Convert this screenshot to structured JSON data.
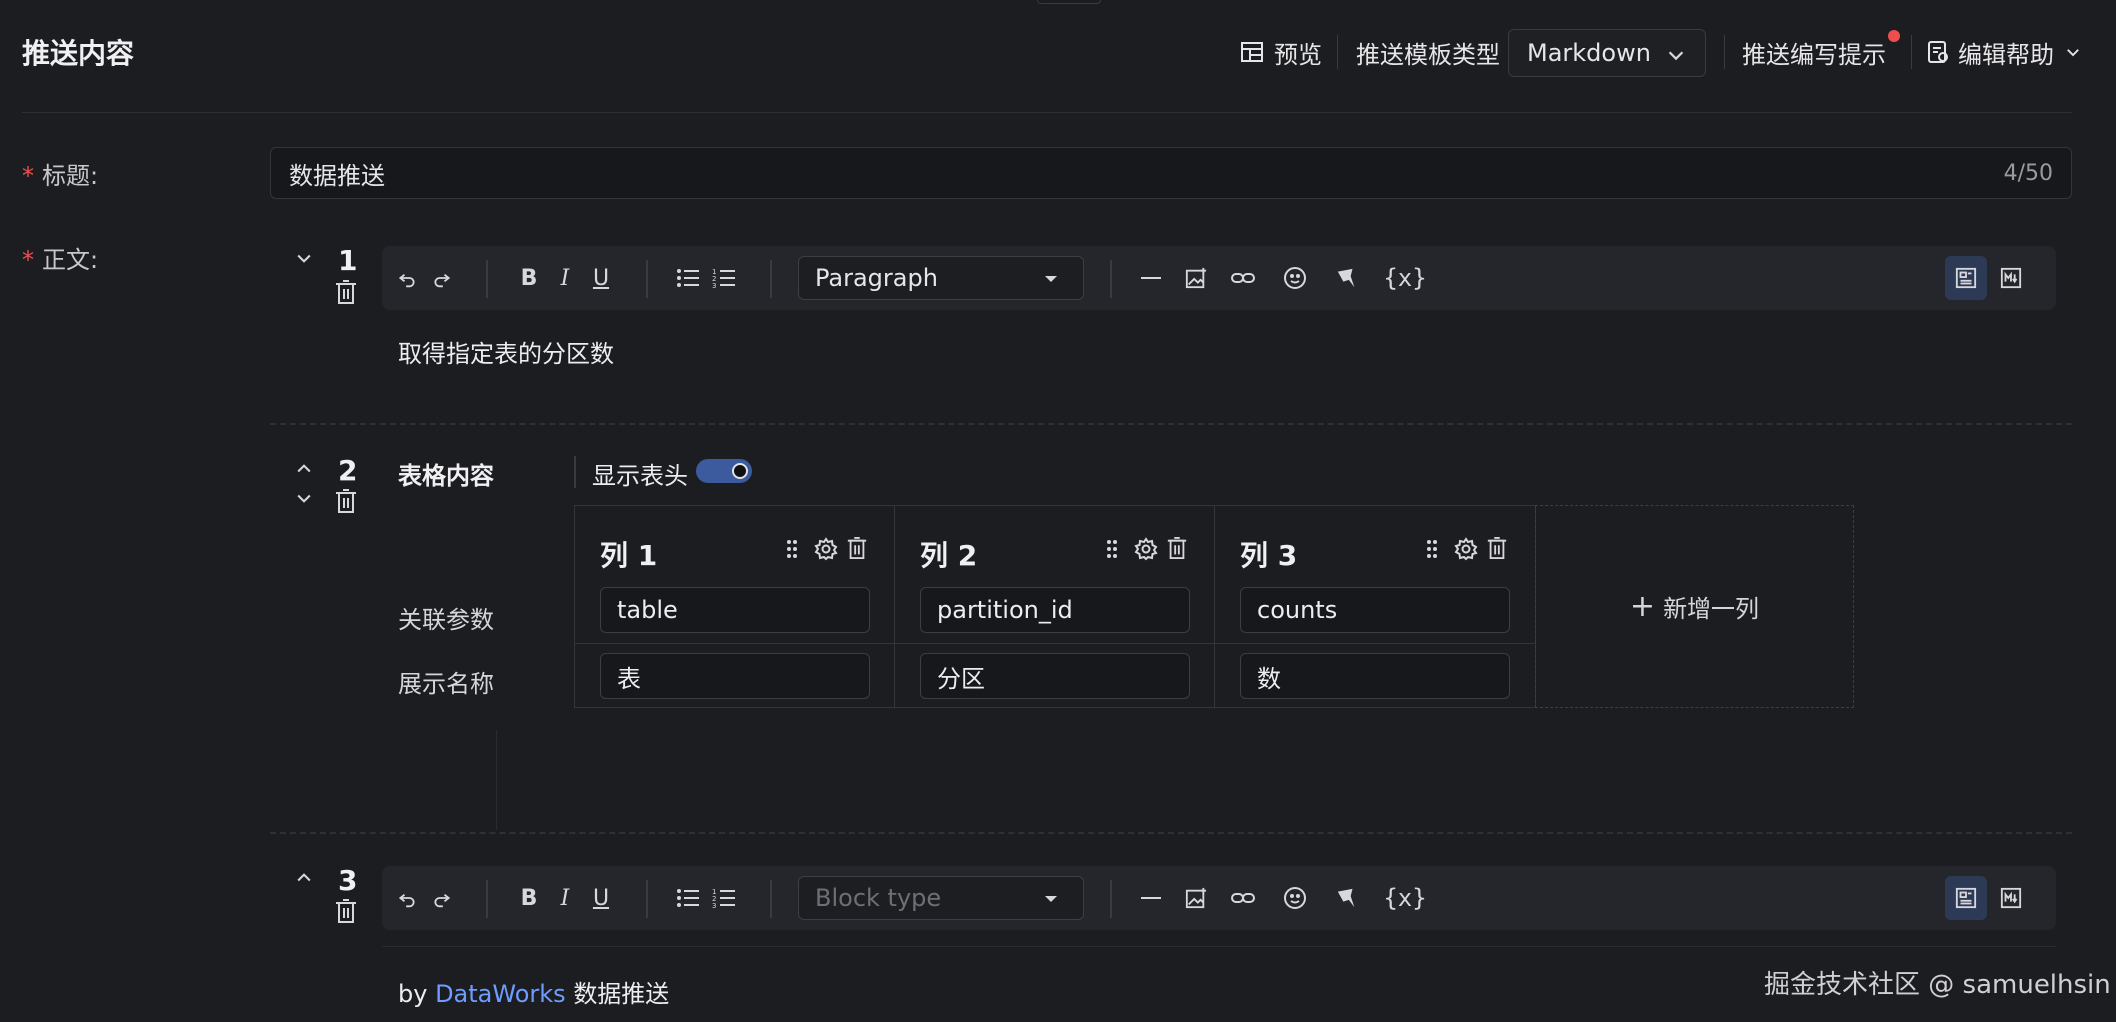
{
  "header": {
    "title": "推送内容",
    "preview_label": "预览",
    "template_type_label": "推送模板类型",
    "template_type_value": "Markdown",
    "tips_label": "推送编写提示",
    "help_label": "编辑帮助"
  },
  "form": {
    "title_label": "标题:",
    "title_value": "数据推送",
    "title_count": "4/50",
    "body_label": "正文:"
  },
  "blocks": [
    {
      "number": "1",
      "block_type": "Paragraph",
      "content": "取得指定表的分区数"
    },
    {
      "number": "2",
      "title": "表格内容",
      "show_header_label": "显示表头",
      "show_header_on": true,
      "row_labels": [
        "关联参数",
        "展示名称"
      ],
      "columns": [
        {
          "name": "列 1",
          "param": "table",
          "display": "表"
        },
        {
          "name": "列 2",
          "param": "partition_id",
          "display": "分区"
        },
        {
          "name": "列 3",
          "param": "counts",
          "display": "数"
        }
      ],
      "add_column_label": "新增一列"
    },
    {
      "number": "3",
      "block_type_placeholder": "Block type",
      "content_prefix": "by",
      "content_link": "DataWorks",
      "content_suffix": "数据推送"
    }
  ],
  "toolbar": {
    "variable_label": "{x}",
    "bold": "B",
    "italic": "I",
    "underline": "U"
  },
  "watermark": "掘金技术社区 @ samuelhsin",
  "colors": {
    "background": "#1c1d21",
    "accent": "#3c5b9e",
    "link": "#6f9cff",
    "required": "#f04e4e"
  }
}
